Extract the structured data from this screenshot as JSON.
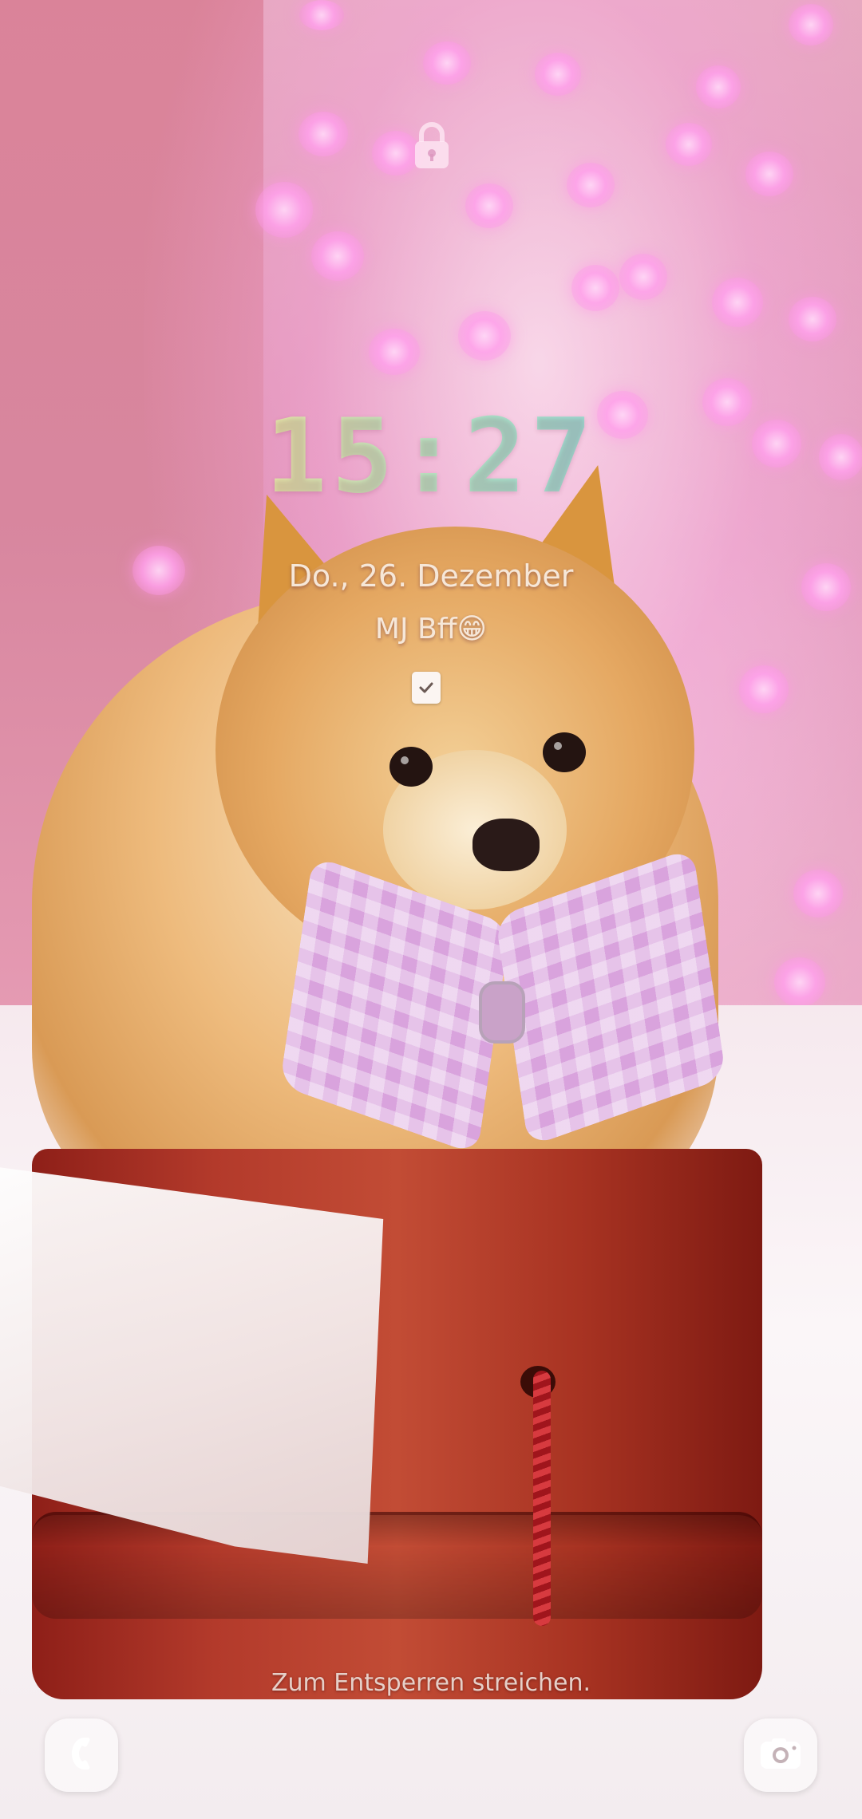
{
  "lockscreen": {
    "time": "15:27",
    "date": "Do., 26. Dezember",
    "owner_info": "MJ Bff😁",
    "unlock_hint": "Zum Entsperren streichen."
  },
  "icons": {
    "lock": "lock-icon",
    "notification": "checkbox-notification-icon",
    "left_shortcut": "phone-icon",
    "right_shortcut": "camera-icon"
  },
  "colors": {
    "clock_gradient_start": "#f2e8a6",
    "clock_gradient_end": "#8ed8dc",
    "text_light": "#f6e7d8"
  }
}
